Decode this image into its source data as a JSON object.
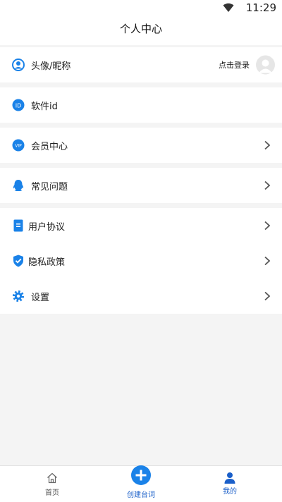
{
  "status_bar": {
    "time": "11:29"
  },
  "page_title": "个人中心",
  "profile": {
    "label": "头像/昵称",
    "login_text": "点击登录"
  },
  "software": {
    "label": "软件id"
  },
  "vip": {
    "label": "会员中心"
  },
  "faq": {
    "label": "常见问题"
  },
  "agreement": {
    "label": "用户协议"
  },
  "privacy": {
    "label": "隐私政策"
  },
  "settings": {
    "label": "设置"
  },
  "tabbar": {
    "home": "首页",
    "create": "创建台词",
    "mine": "我的"
  },
  "colors": {
    "accent": "#1a82e8",
    "active_tab": "#1a5fc9"
  }
}
